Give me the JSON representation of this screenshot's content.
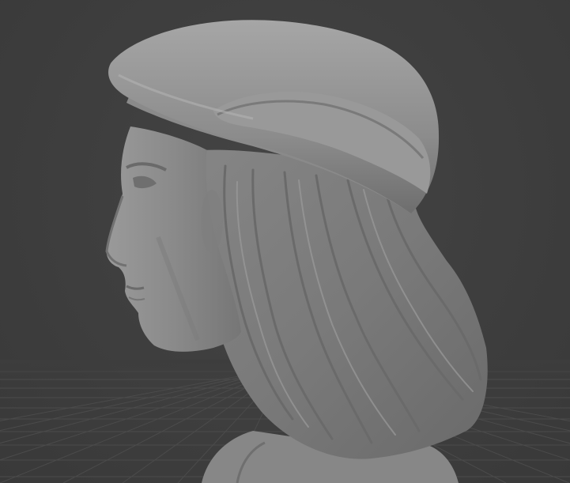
{
  "viewport": {
    "background_color": "#3d3d3d",
    "grid_color": "#4a4a4a",
    "model_color": "#8e8e8e",
    "grid_visible": true,
    "model": "sculpted-bust-with-beret"
  }
}
